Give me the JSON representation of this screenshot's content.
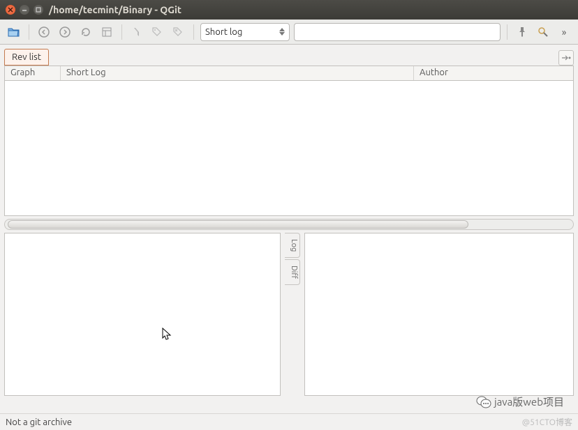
{
  "window": {
    "title": "/home/tecmint/Binary - QGit"
  },
  "toolbar": {
    "selector_value": "Short log",
    "search_value": ""
  },
  "tabs": {
    "rev_list": "Rev list"
  },
  "columns": {
    "graph": "Graph",
    "shortlog": "Short Log",
    "author": "Author"
  },
  "side_tabs": {
    "log": "Log",
    "diff": "Diff"
  },
  "status": "Not a git archive",
  "watermarks": {
    "w1": "java版web项目",
    "w2": "@51CTO博客"
  }
}
